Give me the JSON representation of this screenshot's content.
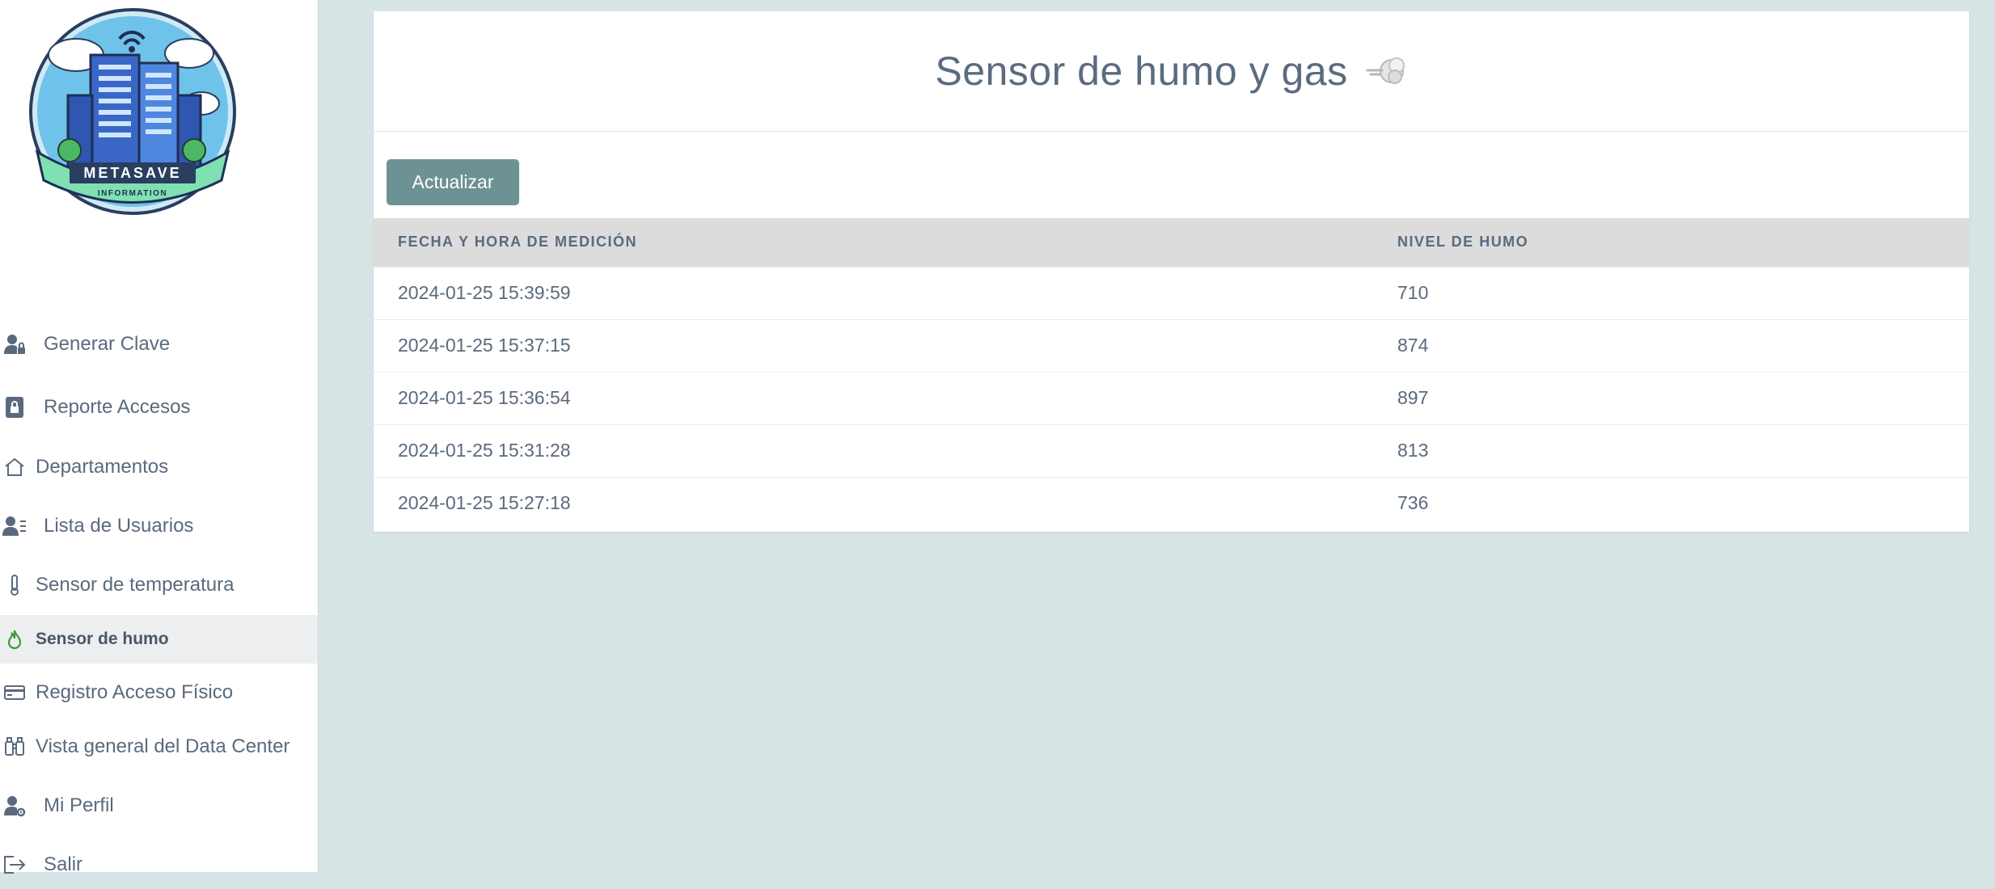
{
  "logo": {
    "brand": "METASAVE",
    "tagline": "INFORMATION"
  },
  "sidebar": {
    "items": [
      {
        "label": "Generar Clave",
        "icon": "user-lock-icon"
      },
      {
        "label": "Reporte Accesos",
        "icon": "lock-icon"
      },
      {
        "label": "Departamentos",
        "icon": "house-icon"
      },
      {
        "label": "Lista de Usuarios",
        "icon": "user-list-icon"
      },
      {
        "label": "Sensor de temperatura",
        "icon": "thermometer-icon"
      },
      {
        "label": "Sensor de humo",
        "icon": "fire-icon",
        "active": true
      },
      {
        "label": "Registro Acceso Físico",
        "icon": "credit-card-icon"
      },
      {
        "label": "Vista general del Data Center",
        "icon": "binoculars-icon"
      },
      {
        "label": "Mi Perfil",
        "icon": "user-gear-icon"
      },
      {
        "label": "Salir",
        "icon": "logout-icon"
      }
    ]
  },
  "main": {
    "title": "Sensor de humo y gas",
    "title_icon": "smoke-icon",
    "refresh_label": "Actualizar",
    "table": {
      "headers": [
        "Fecha y hora de medición",
        "Nivel de humo"
      ],
      "rows": [
        [
          "2024-01-25 15:39:59",
          "710"
        ],
        [
          "2024-01-25 15:37:15",
          "874"
        ],
        [
          "2024-01-25 15:36:54",
          "897"
        ],
        [
          "2024-01-25 15:31:28",
          "813"
        ],
        [
          "2024-01-25 15:27:18",
          "736"
        ]
      ]
    }
  },
  "colors": {
    "background": "#d7e4e6",
    "button": "#6d9294",
    "text": "#5a6a7e",
    "active_icon": "#3f9a3a"
  }
}
